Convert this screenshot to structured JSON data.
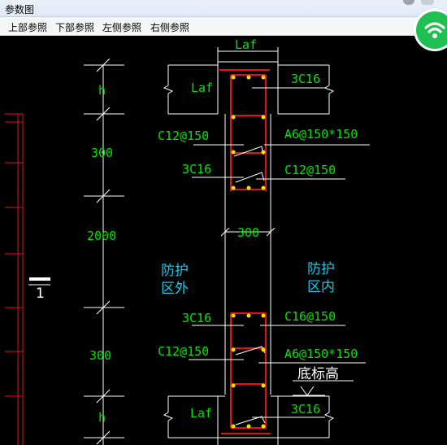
{
  "window": {
    "title": "参数图"
  },
  "menu": {
    "items": [
      "上部参照",
      "下部参照",
      "左侧参照",
      "右侧参照"
    ]
  },
  "drawing": {
    "dim_left": {
      "top_h": "h",
      "upper_300": "300",
      "middle": "2000",
      "lower_300": "300",
      "bottom_h": "h"
    },
    "top_dim": "Laf",
    "mid_dim": "300",
    "section_mark": "1",
    "labels": {
      "laf_top": "Laf",
      "laf_bottom": "Laf",
      "bar_top": "3C16",
      "bar_upper_left": "3C16",
      "bar_lower_left": "3C16",
      "bar_bottom": "3C16",
      "stirrup_upper_left": "C12@150",
      "stirrup_upper_right": "C12@150",
      "stirrup_lower_left": "C12@150",
      "stirrup_lower_right": "C16@150",
      "tie_upper": "A6@150*150",
      "tie_lower": "A6@150*150",
      "outside": [
        "防护",
        "区外"
      ],
      "inside": [
        "防护",
        "区内"
      ],
      "bottom_elev": "底标高"
    }
  },
  "colors": {
    "cad_green": "#00e400",
    "cad_cyan": "#18c8e8",
    "cad_red": "#e81010",
    "cad_white": "#ffffff",
    "cad_yellow": "#ffe000",
    "wifi_badge": "#1fbf52"
  },
  "icons": {
    "wifi": "wifi-icon"
  }
}
